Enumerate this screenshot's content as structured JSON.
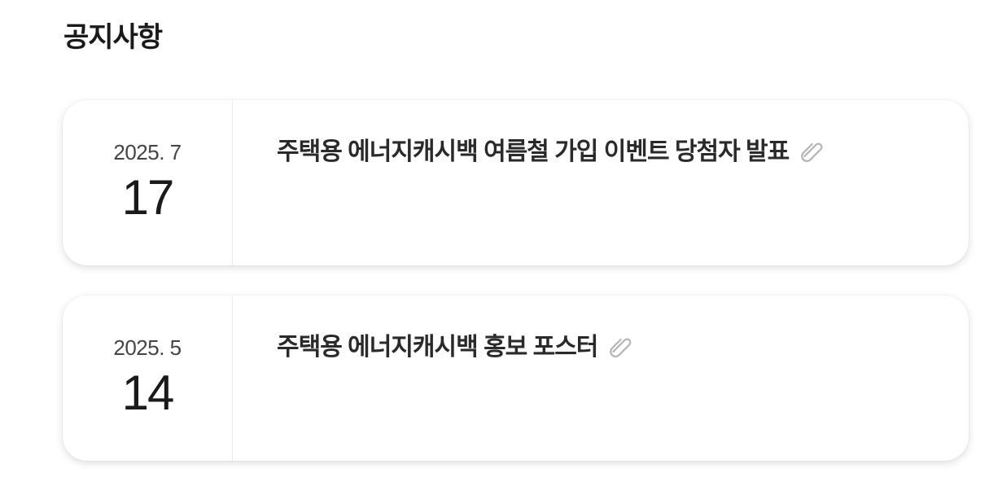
{
  "section": {
    "title": "공지사항"
  },
  "notices": [
    {
      "date_ym": "2025. 7",
      "date_day": "17",
      "title": "주택용 에너지캐시백 여름철 가입 이벤트 당첨자 발표",
      "attachment_icon": "paperclip-icon"
    },
    {
      "date_ym": "2025. 5",
      "date_day": "14",
      "title": "주택용 에너지캐시백 홍보 포스터",
      "attachment_icon": "paperclip-icon"
    }
  ],
  "colors": {
    "title_text": "#1a1a1a",
    "card_background": "#ffffff",
    "icon_gray": "#b5b5b5"
  }
}
